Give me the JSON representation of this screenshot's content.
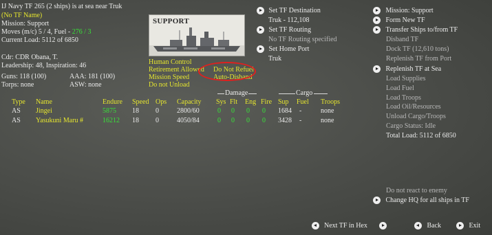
{
  "tf_info": {
    "title": "IJ Navy TF 265 (2 ships) is at sea near Truk",
    "tf_name": "(No TF Name)",
    "mission": "Mission: Support",
    "moves_prefix": "Moves (m/c)  5 / 4,  Fuel - ",
    "moves_fuel": "276 / 3",
    "current_load": "Current Load:  5112 of 6850",
    "commander": "Cdr: CDR  Obana, T.",
    "leadership": "Leadership: 48, Inspiration: 46",
    "guns": "Guns:  118 (100)",
    "aaa": "AAA:  181 (100)",
    "torps": "Torps: none",
    "asw": "ASW: none"
  },
  "support_image": {
    "label": "SUPPORT"
  },
  "settings": {
    "human_control": "Human Control",
    "retirement": "Retirement Allowed",
    "do_not_refuel": "Do Not Refuel",
    "mission_speed": "Mission Speed",
    "auto_disband": "Auto-Disband",
    "do_not_unload": "Do not Unload"
  },
  "destination": {
    "set_tf_destination": "Set TF Destination",
    "dest_value": "Truk - 112,108",
    "set_tf_routing": "Set TF Routing",
    "routing_value": "No TF Routing specified",
    "set_home_port": "Set Home Port",
    "home_port_value": "Truk"
  },
  "right_menu": {
    "mission": "Mission: Support",
    "form_new_tf": "Form New TF",
    "transfer_ships": "Transfer Ships to/from TF",
    "disband_tf": "Disband TF",
    "dock_tf": "Dock TF (12,610 tons)",
    "replenish_port": "Replenish TF from Port",
    "replenish_sea": "Replenish TF at Sea",
    "load_supplies": "Load Supplies",
    "load_fuel": "Load Fuel",
    "load_troops": "Load Troops",
    "load_oil": "Load Oil/Resources",
    "unload_cargo": "Unload Cargo/Troops",
    "cargo_status": "Cargo Status: Idle",
    "total_load": "Total Load:  5112 of 6850",
    "do_not_react": "Do not react to enemy",
    "change_hq": "Change HQ for all ships in TF"
  },
  "table": {
    "group_damage": "Damage",
    "group_cargo": "Cargo",
    "headers": {
      "type": "Type",
      "name": "Name",
      "endure": "Endure",
      "speed": "Speed",
      "ops": "Ops",
      "capacity": "Capacity",
      "sys": "Sys",
      "flt": "Flt",
      "eng": "Eng",
      "fire": "Fire",
      "sup": "Sup",
      "fuel": "Fuel",
      "troops": "Troops"
    },
    "rows": [
      {
        "type": "AS",
        "name": "Jingei",
        "endure": "5875",
        "speed": "18",
        "ops": "0",
        "capacity": "2800/60",
        "sys": "0",
        "flt": "0",
        "eng": "0",
        "fire": "0",
        "sup": "1684",
        "fuel": "-",
        "troops": "none"
      },
      {
        "type": "AS",
        "name": "Yasukuni Maru #",
        "endure": "16212",
        "speed": "18",
        "ops": "0",
        "capacity": "4050/84",
        "sys": "0",
        "flt": "0",
        "eng": "0",
        "fire": "0",
        "sup": "3428",
        "fuel": "-",
        "troops": "none"
      }
    ]
  },
  "bottom_nav": {
    "next_tf": "Next TF in Hex",
    "back": "Back",
    "exit": "Exit"
  },
  "colors": {
    "yellow": "#e6e62e",
    "green": "#38e438",
    "highlight_oval": "#e0201e"
  }
}
